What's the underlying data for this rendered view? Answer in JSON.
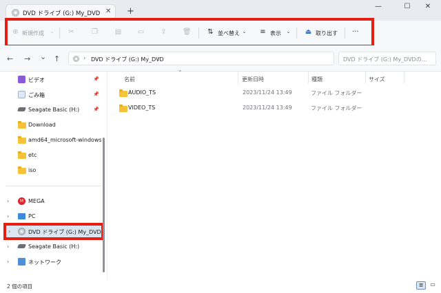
{
  "window": {
    "tab_title": "DVD ドライブ (G:) My_DVD",
    "tab_close": "✕",
    "new_tab": "+",
    "minimize": "—",
    "maximize": "☐",
    "close": "✕"
  },
  "toolbar": {
    "new_label": "新規作成",
    "sort_label": "並べ替え",
    "view_label": "表示",
    "eject_label": "取り出す",
    "more_label": "···"
  },
  "nav": {
    "back": "←",
    "forward": "→",
    "recent": "⌄",
    "up": "↑",
    "address_root": "DVD ドライブ (G:) My_DVD",
    "address_chevron": "›",
    "search_placeholder": "DVD ドライブ (G:) My_DVDの..."
  },
  "sidebar": {
    "items": [
      {
        "label": "ビデオ",
        "icon": "video-folder-icon",
        "pinned": true
      },
      {
        "label": "ごみ箱",
        "icon": "recycle-bin-icon",
        "pinned": true
      },
      {
        "label": "Seagate Basic (H:)",
        "icon": "drive-icon",
        "pinned": true
      },
      {
        "label": "Download",
        "icon": "folder-icon"
      },
      {
        "label": "amd64_microsoft-windows-w",
        "icon": "folder-icon"
      },
      {
        "label": "etc",
        "icon": "folder-icon"
      },
      {
        "label": "iso",
        "icon": "folder-icon"
      },
      {
        "label": "MEGA",
        "icon": "mega-icon",
        "expandable": true
      },
      {
        "label": "PC",
        "icon": "pc-icon",
        "expandable": true
      },
      {
        "label": "DVD ドライブ (G:) My_DVD",
        "icon": "dvd-icon",
        "expandable": true,
        "selected": true
      },
      {
        "label": "Seagate Basic (H:)",
        "icon": "drive-icon",
        "expandable": true
      },
      {
        "label": "ネットワーク",
        "icon": "network-icon",
        "expandable": true
      }
    ]
  },
  "table": {
    "headers": [
      "名前",
      "更新日時",
      "種類",
      "サイズ"
    ],
    "rows": [
      {
        "name": "AUDIO_TS",
        "modified": "2023/11/24 13:49",
        "type": "ファイル フォルダー",
        "size": ""
      },
      {
        "name": "VIDEO_TS",
        "modified": "2023/11/24 13:49",
        "type": "ファイル フォルダー",
        "size": ""
      }
    ]
  },
  "status": {
    "item_count": "2 個の項目"
  },
  "colors": {
    "highlight": "#e51e12",
    "folder": "#f4c33b",
    "mega": "#d9272e"
  }
}
